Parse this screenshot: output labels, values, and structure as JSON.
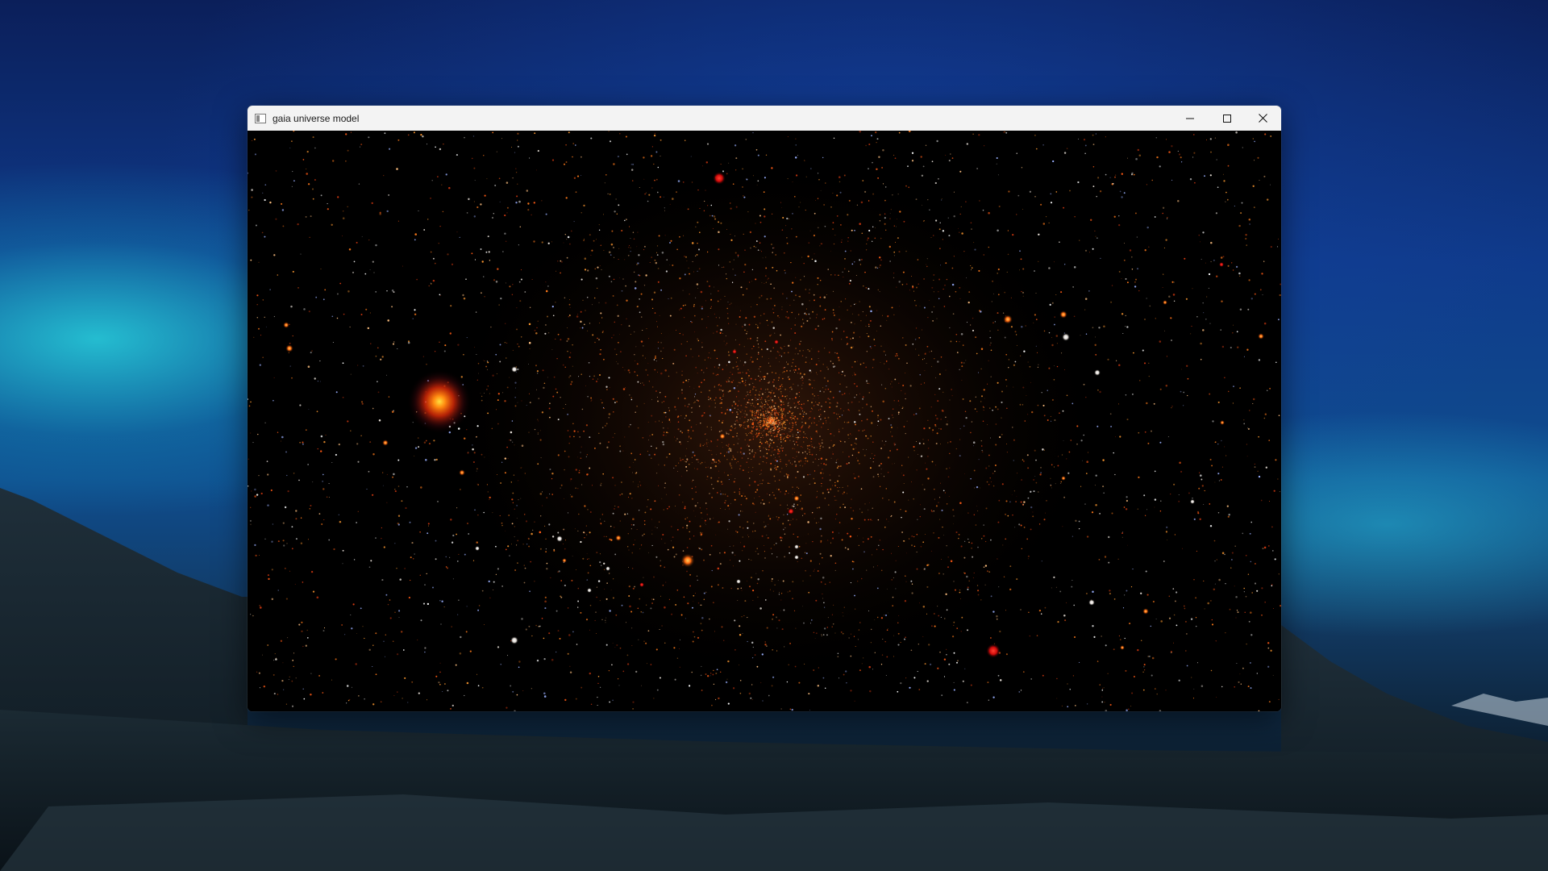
{
  "window": {
    "title": "gaia universe model"
  },
  "titlebar_icons": {
    "app": "app-window-icon",
    "minimize": "minimize-icon",
    "maximize": "maximize-icon",
    "close": "close-icon"
  },
  "colors": {
    "titlebar_bg": "#f3f3f3",
    "canvas_bg": "#000000",
    "star_orange": "#ff7a1a",
    "star_red": "#ff2a1a",
    "star_white": "#ffffff"
  }
}
